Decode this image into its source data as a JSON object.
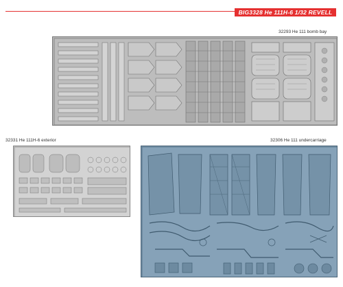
{
  "banner": {
    "text": "BIG3328  He 111H-6  1/32  REVELL",
    "color": "#e53030"
  },
  "sets": [
    {
      "code": "32293",
      "name": "He 111 bomb bay",
      "label": "32293  He 111 bomb bay",
      "fret_color": "#b8b8b8"
    },
    {
      "code": "32331",
      "name": "He 111H-6 exterior",
      "label": "32331   He 111H-6 exterior",
      "fret_color": "#cfcfcf"
    },
    {
      "code": "32306",
      "name": "He 111 undercarriage",
      "label": "32306  He 111 undercarriage",
      "fret_color": "#7f9bb1"
    }
  ]
}
